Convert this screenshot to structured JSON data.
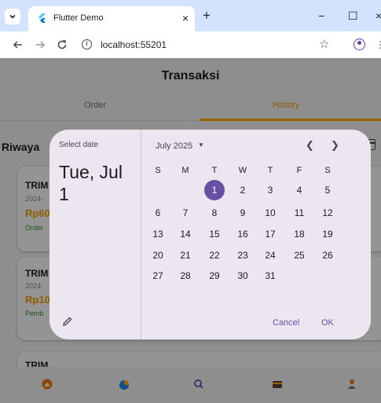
{
  "browser": {
    "tab_title": "Flutter Demo",
    "tab_close": "×",
    "new_tab": "+",
    "minimize": "−",
    "maximize": "☐",
    "close": "×",
    "url": "localhost:55201"
  },
  "app": {
    "title": "Transaksi",
    "tabs": [
      {
        "label": "Order",
        "selected": false
      },
      {
        "label": "History",
        "selected": true
      }
    ],
    "section_title": "Riwaya",
    "cards": [
      {
        "title": "TRIM",
        "date": "2024-",
        "amount": "Rp60",
        "status": "Order"
      },
      {
        "title": "TRIM",
        "date": "2024-",
        "amount": "Rp10",
        "status": "Pemb"
      },
      {
        "title": "TRIM",
        "date": "",
        "amount": "",
        "status": ""
      }
    ],
    "accent_color": "#ffb300"
  },
  "bottom_nav": {
    "icons": [
      "home-icon",
      "pie-chart-icon",
      "search-icon",
      "wallet-icon",
      "person-icon"
    ]
  },
  "date_picker": {
    "help_text": "Select date",
    "headline": "Tue, Jul 1",
    "month_label": "July 2025",
    "weekdays": [
      "S",
      "M",
      "T",
      "W",
      "T",
      "F",
      "S"
    ],
    "weeks": [
      [
        "",
        "",
        "1",
        "2",
        "3",
        "4",
        "5"
      ],
      [
        "6",
        "7",
        "8",
        "9",
        "10",
        "11",
        "12"
      ],
      [
        "13",
        "14",
        "15",
        "16",
        "17",
        "18",
        "19"
      ],
      [
        "20",
        "21",
        "22",
        "23",
        "24",
        "25",
        "26"
      ],
      [
        "27",
        "28",
        "29",
        "30",
        "31",
        "",
        ""
      ]
    ],
    "selected_day": "1",
    "cancel_label": "Cancel",
    "ok_label": "OK",
    "primary_color": "#6750a4"
  }
}
